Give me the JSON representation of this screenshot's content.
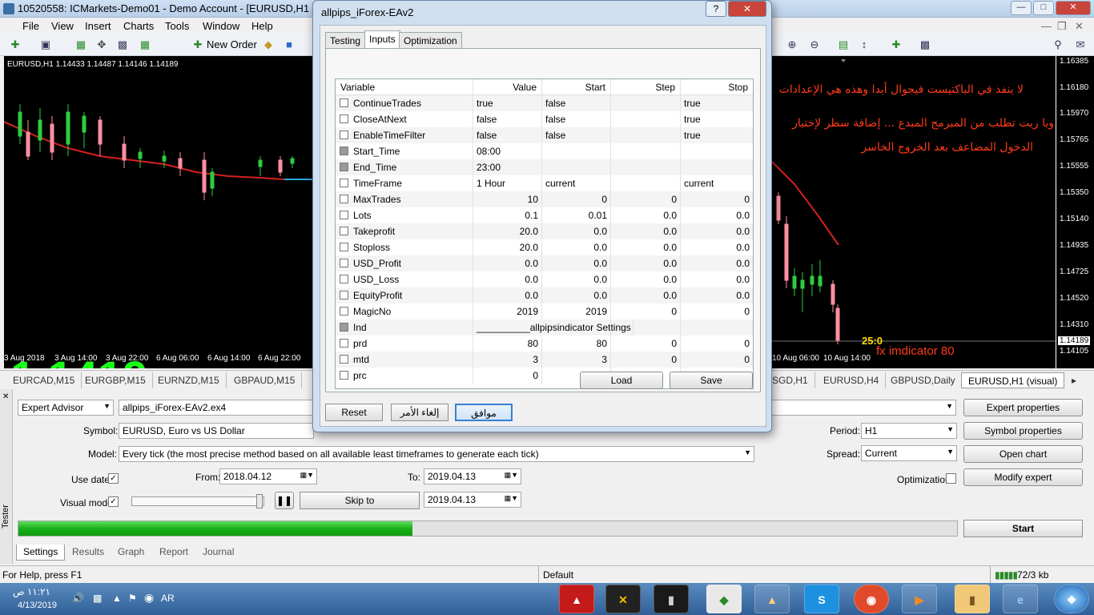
{
  "window": {
    "title": "10520558: ICMarkets-Demo01 - Demo Account - [EURUSD,H1 (visual)]"
  },
  "menu": [
    "File",
    "View",
    "Insert",
    "Charts",
    "Tools",
    "Window",
    "Help"
  ],
  "toolbar": {
    "new_order": "New Order"
  },
  "chart": {
    "header": "EURUSD,H1  1.14433 1.14487 1.14146 1.14189",
    "big_price": "1.1419",
    "time_labels_left": [
      "3 Aug 2018",
      "3 Aug 14:00",
      "3 Aug 22:00",
      "6 Aug 06:00",
      "6 Aug 14:00",
      "6 Aug 22:00"
    ],
    "time_labels_right": [
      "10 Aug 06:00",
      "10 Aug 14:00"
    ],
    "price_scale": [
      "1.16385",
      "1.16180",
      "1.15970",
      "1.15765",
      "1.15555",
      "1.15350",
      "1.15140",
      "1.14935",
      "1.14725",
      "1.14520",
      "1.14310",
      "1.14189",
      "1.14105"
    ],
    "indicator_value": "25:0",
    "indicator_label": "fx imdicator 80",
    "annotation": [
      "لا ينفذ في الباكتيست فيجوال أبدا وهذه هي الإعدادات",
      "وبا ريت تطلب من المبرمج المبدع ... إضافة سطر لإختيار",
      "الدخول المضاعف بعد الخروج الخاسر"
    ]
  },
  "chart_tabs": [
    "EURCAD,M15",
    "EURGBP,M15",
    "EURNZD,M15",
    "GBPAUD,M15",
    "SGD,H1",
    "EURUSD,H4",
    "GBPUSD,Daily",
    "EURUSD,H1 (visual)"
  ],
  "dialog": {
    "title": "allpips_iForex-EAv2",
    "tabs": [
      "Testing",
      "Inputs",
      "Optimization"
    ],
    "columns": [
      "Variable",
      "Value",
      "Start",
      "Step",
      "Stop"
    ],
    "rows": [
      {
        "name": "ContinueTrades",
        "value": "true",
        "start": "false",
        "step": "",
        "stop": "true"
      },
      {
        "name": "CloseAtNext",
        "value": "false",
        "start": "false",
        "step": "",
        "stop": "true"
      },
      {
        "name": "EnableTimeFilter",
        "value": "false",
        "start": "false",
        "step": "",
        "stop": "true"
      },
      {
        "name": "Start_Time",
        "value": "08:00",
        "start": "",
        "step": "",
        "stop": ""
      },
      {
        "name": "End_Time",
        "value": "23:00",
        "start": "",
        "step": "",
        "stop": ""
      },
      {
        "name": "TimeFrame",
        "value": "1 Hour",
        "start": "current",
        "step": "",
        "stop": "current"
      },
      {
        "name": "MaxTrades",
        "value": "10",
        "start": "0",
        "step": "0",
        "stop": "0"
      },
      {
        "name": "Lots",
        "value": "0.1",
        "start": "0.01",
        "step": "0.0",
        "stop": "0.0"
      },
      {
        "name": "Takeprofit",
        "value": "20.0",
        "start": "0.0",
        "step": "0.0",
        "stop": "0.0"
      },
      {
        "name": "Stoploss",
        "value": "20.0",
        "start": "0.0",
        "step": "0.0",
        "stop": "0.0"
      },
      {
        "name": "USD_Profit",
        "value": "0.0",
        "start": "0.0",
        "step": "0.0",
        "stop": "0.0"
      },
      {
        "name": "USD_Loss",
        "value": "0.0",
        "start": "0.0",
        "step": "0.0",
        "stop": "0.0"
      },
      {
        "name": "EquityProfit",
        "value": "0.0",
        "start": "0.0",
        "step": "0.0",
        "stop": "0.0"
      },
      {
        "name": "MagicNo",
        "value": "2019",
        "start": "2019",
        "step": "0",
        "stop": "0"
      },
      {
        "name": "Ind",
        "value": "__________allpipsindicator Settings",
        "start": "",
        "step": "",
        "stop": ""
      },
      {
        "name": "prd",
        "value": "80",
        "start": "80",
        "step": "0",
        "stop": "0"
      },
      {
        "name": "mtd",
        "value": "3",
        "start": "3",
        "step": "0",
        "stop": "0"
      },
      {
        "name": "prc",
        "value": "0",
        "start": "0",
        "step": "0",
        "stop": "0"
      }
    ],
    "load": "Load",
    "save": "Save",
    "reset": "Reset",
    "cancel": "إلغاء الأمر",
    "ok": "موافق"
  },
  "tester": {
    "type": "Expert Advisor",
    "expert": "allpips_iForex-EAv2.ex4",
    "symbol_label": "Symbol:",
    "symbol": "EURUSD, Euro vs US Dollar",
    "model_label": "Model:",
    "model": "Every tick (the most precise method based on all available least timeframes to generate each tick)",
    "use_date": "Use date",
    "from_label": "From:",
    "from": "2018.04.12",
    "to_label": "To:",
    "to": "2019.04.13",
    "visual_mode": "Visual mode",
    "skip_to": "Skip to",
    "skip_date": "2019.04.13",
    "period_label": "Period:",
    "period": "H1",
    "spread_label": "Spread:",
    "spread": "Current",
    "optimization": "Optimization",
    "buttons": [
      "Expert properties",
      "Symbol properties",
      "Open chart",
      "Modify expert"
    ],
    "start": "Start",
    "progress": 0.42,
    "tabs": [
      "Settings",
      "Results",
      "Graph",
      "Report",
      "Journal"
    ],
    "side_label": "Tester"
  },
  "status": {
    "help": "For Help, press F1",
    "profile": "Default",
    "traffic": "72/3 kb"
  },
  "taskbar": {
    "time": "١١:٢١ ص",
    "date": "4/13/2019",
    "lang": "AR"
  }
}
